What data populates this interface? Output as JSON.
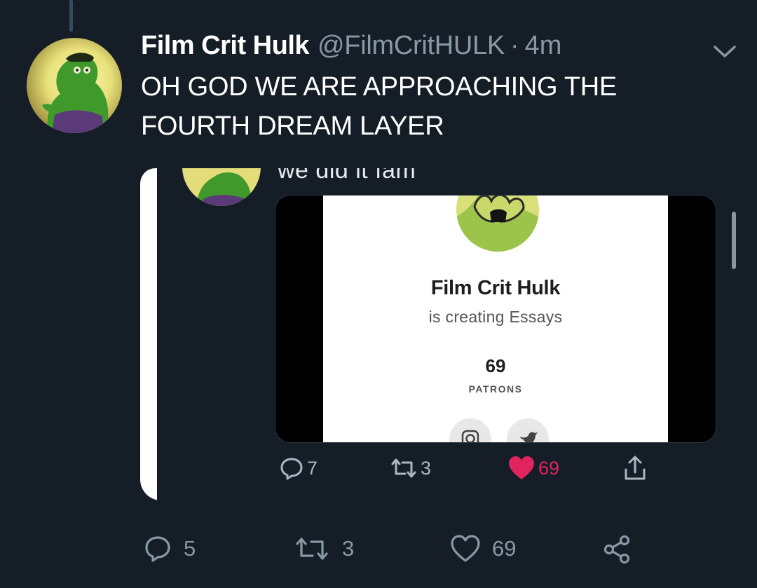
{
  "tweet": {
    "author_name": "Film Crit Hulk",
    "handle": "@FilmCritHULK",
    "separator": "·",
    "time": "4m",
    "text": "OH GOD WE ARE APPROACHING THE FOURTH DREAM LAYER"
  },
  "embedded": {
    "partial_text": "we did it fam",
    "patreon": {
      "name": "Film Crit Hulk",
      "subtitle": "is creating Essays",
      "patron_count": "69",
      "patron_label": "PATRONS"
    },
    "actions": {
      "replies": "7",
      "retweets": "3",
      "likes": "69"
    }
  },
  "actions": {
    "replies": "5",
    "retweets": "3",
    "likes": "69"
  },
  "colors": {
    "background": "#151d27",
    "secondary_text": "#8899a6",
    "like_red": "#e0245e"
  },
  "icons": {
    "menu": "chevron-down-icon",
    "reply": "reply-icon",
    "retweet": "retweet-icon",
    "like": "heart-icon",
    "share": "share-icon"
  }
}
